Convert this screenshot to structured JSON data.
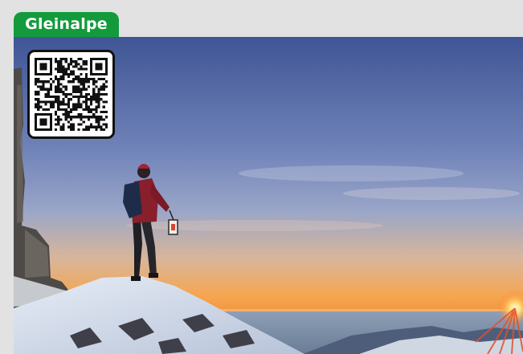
{
  "header": {
    "title": "Gleinalpe",
    "tab_color": "#139a3c"
  },
  "photo": {
    "subject": "hiker-with-lantern-at-sunrise-image",
    "sky_colors": [
      "#4b5f9c",
      "#8a97c0",
      "#f4a24c"
    ],
    "sun_color": "#ffe07a"
  },
  "qr": {
    "icon": "qr-code-icon"
  }
}
